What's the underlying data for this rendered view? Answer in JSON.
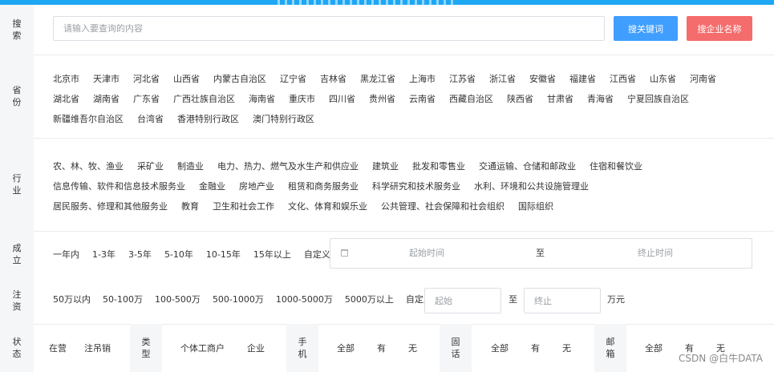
{
  "search": {
    "label": "搜索",
    "placeholder": "请输入要查询的内容",
    "btn_keyword": "搜关键词",
    "btn_company": "搜企业名称"
  },
  "province": {
    "label": "省份",
    "items": [
      "北京市",
      "天津市",
      "河北省",
      "山西省",
      "内蒙古自治区",
      "辽宁省",
      "吉林省",
      "黑龙江省",
      "上海市",
      "江苏省",
      "浙江省",
      "安徽省",
      "福建省",
      "江西省",
      "山东省",
      "河南省",
      "湖北省",
      "湖南省",
      "广东省",
      "广西壮族自治区",
      "海南省",
      "重庆市",
      "四川省",
      "贵州省",
      "云南省",
      "西藏自治区",
      "陕西省",
      "甘肃省",
      "青海省",
      "宁夏回族自治区",
      "新疆维吾尔自治区",
      "台湾省",
      "香港特别行政区",
      "澳门特别行政区"
    ]
  },
  "industry": {
    "label": "行业",
    "items": [
      "农、林、牧、渔业",
      "采矿业",
      "制造业",
      "电力、热力、燃气及水生产和供应业",
      "建筑业",
      "批发和零售业",
      "交通运输、仓储和邮政业",
      "住宿和餐饮业",
      "信息传输、软件和信息技术服务业",
      "金融业",
      "房地产业",
      "租赁和商务服务业",
      "科学研究和技术服务业",
      "水利、环境和公共设施管理业",
      "居民服务、修理和其他服务业",
      "教育",
      "卫生和社会工作",
      "文化、体育和娱乐业",
      "公共管理、社会保障和社会组织",
      "国际组织"
    ]
  },
  "established": {
    "label": "成立",
    "options": [
      "一年内",
      "1-3年",
      "3-5年",
      "5-10年",
      "10-15年",
      "15年以上",
      "自定义"
    ],
    "start_placeholder": "起始时间",
    "to": "至",
    "end_placeholder": "终止时间"
  },
  "capital": {
    "label": "注资",
    "options": [
      "50万以内",
      "50-100万",
      "100-500万",
      "500-1000万",
      "1000-5000万",
      "5000万以上",
      "自定义"
    ],
    "start_placeholder": "起始",
    "to": "至",
    "end_placeholder": "终止",
    "unit": "万元"
  },
  "status": {
    "label": "状态",
    "options": [
      "在营",
      "注吊销"
    ],
    "type_label": "类型",
    "type_options": [
      "个体工商户",
      "企业"
    ],
    "mobile_label": "手机",
    "mobile_options": [
      "全部",
      "有",
      "无"
    ],
    "phone_label": "固话",
    "phone_options": [
      "全部",
      "有",
      "无"
    ],
    "email_label": "邮箱",
    "email_options": [
      "全部",
      "有",
      "无"
    ]
  },
  "watermark": "CSDN @白牛DATA"
}
